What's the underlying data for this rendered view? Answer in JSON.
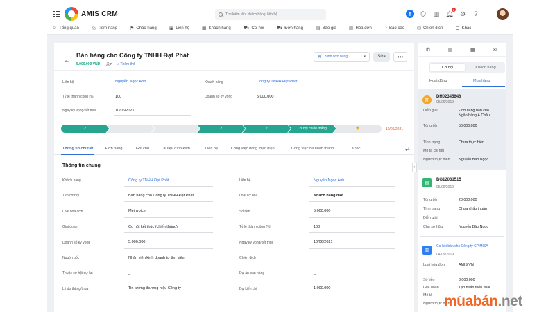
{
  "app": {
    "name": "AMIS CRM"
  },
  "search": {
    "placeholder": "Tìm kiếm tên, khách hàng, liên hệ"
  },
  "notifications": {
    "count": "2"
  },
  "nav": [
    {
      "label": "Tổng quan",
      "icon": "☺"
    },
    {
      "label": "Tiềm năng",
      "icon": "◎"
    },
    {
      "label": "Chào hàng",
      "icon": "⚑"
    },
    {
      "label": "Liên hệ",
      "icon": "▣"
    },
    {
      "label": "Khách hàng",
      "icon": "▦"
    },
    {
      "label": "Cơ hội",
      "icon": "⛟"
    },
    {
      "label": "Đơn hàng",
      "icon": "⛟"
    },
    {
      "label": "Báo giá",
      "icon": "▤"
    },
    {
      "label": "Hóa đơn",
      "icon": "▥"
    },
    {
      "label": "Báo cáo",
      "icon": "◔"
    },
    {
      "label": "Chiến dịch",
      "icon": "✉"
    },
    {
      "label": "Khác",
      "icon": "☰"
    }
  ],
  "header": {
    "title": "Bán hàng cho Công ty TNHH Đạt Phát",
    "amount": "5.000.000  VNĐ",
    "add_tag": "Thêm thẻ",
    "action_type": "Sinh đơn hàng",
    "edit": "Sửa",
    "more": "•••"
  },
  "summary": {
    "contact_label": "Liên hệ",
    "contact_value": "Nguyễn Ngọc Anh",
    "customer_label": "Khách hàng",
    "customer_value": "Công ty TNHH Đạt Phát",
    "rate_label": "Tỷ lệ thành công (%)",
    "rate_value": "100",
    "revenue_label": "Doanh số kỳ vọng",
    "revenue_value": "5.000.000",
    "date_label": "Ngày kỳ vọng/kết thúc",
    "date_value": "10/06/2021"
  },
  "stages": [
    {
      "label": "✓",
      "state": "done"
    },
    {
      "label": "",
      "state": "todo"
    },
    {
      "label": "",
      "state": "todo"
    },
    {
      "label": "✓",
      "state": "done"
    },
    {
      "label": "✓",
      "state": "done"
    },
    {
      "label": "Cơ hội chiến thắng",
      "state": "done"
    },
    {
      "label": "👎",
      "state": "todo"
    }
  ],
  "stage_date": "10/06/2021",
  "tabs": [
    "Thông tin chi tiết",
    "Đơn hàng",
    "Ghi chú",
    "Tài liệu đính kèm",
    "Liên hệ",
    "Công việc đang thực hiện",
    "Công việc đã hoàn thành",
    "Khác"
  ],
  "section_title": "Thông tin chung",
  "fields_left": [
    {
      "label": "Khách hàng",
      "value": "Công ty TNHH Đạt Phát"
    },
    {
      "label": "Tên cơ hội",
      "value": "Bán hàng cho Công ty TNHH Đạt Phát"
    },
    {
      "label": "Loại hóa đơn",
      "value": "Meinvoice"
    },
    {
      "label": "Giai đoạn",
      "value": "Cơ hội kết thúc (chiến thắng)"
    },
    {
      "label": "Doanh số kỳ vọng",
      "value": "5.000.000"
    },
    {
      "label": "Nguồn gốc",
      "value": "Nhân viên kinh doanh tự tìm kiếm"
    },
    {
      "label": "Thuộc cơ hội dự án",
      "value": "_"
    },
    {
      "label": "Lý do thắng/thua",
      "value": "Tin tưởng thương hiệu Công ty"
    }
  ],
  "fields_right": [
    {
      "label": "Liên hệ",
      "value": "Nguyễn Ngọc Anh"
    },
    {
      "label": "Loại cơ hội",
      "value": "Khách hàng mới"
    },
    {
      "label": "Số tiền",
      "value": "5.000.000"
    },
    {
      "label": "Tỷ lệ thành công (%)",
      "value": "100"
    },
    {
      "label": "Ngày kỳ vọng/kết thúc",
      "value": "10/06/2021"
    },
    {
      "label": "Chiến dịch",
      "value": "_"
    },
    {
      "label": "Dự án bán hàng",
      "value": "_"
    },
    {
      "label": "Dự kiến chi",
      "value": "1.000.000"
    }
  ],
  "side": {
    "toggle_on": "Cơ hội",
    "toggle_off": "Khách hàng",
    "tab_activity": "Hoạt động",
    "tab_purchase": "Mua hàng",
    "order1": {
      "code": "DH02345646",
      "date": "05/09/2019",
      "rows": [
        {
          "label": "Diễn giải",
          "value": "Đơn hàng bán cho"
        },
        {
          "label": "",
          "value": "Ngân hàng Á Châu"
        },
        {
          "label": "Tổng tiền",
          "value": "50.000.000"
        },
        {
          "label": "Tình trạng",
          "value": "Chưa thực hiện"
        },
        {
          "label": "Mô tả chi tiết",
          "value": "_"
        },
        {
          "label": "Người thực hiện",
          "value": "Nguyễn Bảo Ngọc"
        }
      ]
    },
    "order2": {
      "code": "BG12031515",
      "date": "05/09/2019",
      "rows": [
        {
          "label": "Tổng tiền",
          "value": "20.000.000"
        },
        {
          "label": "Tình trạng",
          "value": "Chưa chấp thuận"
        },
        {
          "label": "Diễn giải",
          "value": "_"
        },
        {
          "label": "Chủ sở hữu",
          "value": "Nguyễn Bảo Ngọc"
        }
      ]
    },
    "order3": {
      "code": "Cơ hội bán cho Công ty CP MISA",
      "date": "04/09/2019",
      "rows": [
        {
          "label": "Loại hóa đơn",
          "value": "AMIS.VN"
        },
        {
          "label": "Số tiền",
          "value": "3.000.000"
        },
        {
          "label": "Giai đoạn",
          "value": "Tập huấn triển khai"
        },
        {
          "label": "Mô tả",
          "value": "_"
        },
        {
          "label": "Người thực hiện",
          "value": ""
        }
      ]
    }
  },
  "watermark": {
    "part1": "muabán",
    "part2": ".net"
  },
  "colors": {
    "accent": "#2f6fdb",
    "stage_done": "#26a690",
    "stage_date": "#e5532d",
    "watermark": "#f26522"
  }
}
